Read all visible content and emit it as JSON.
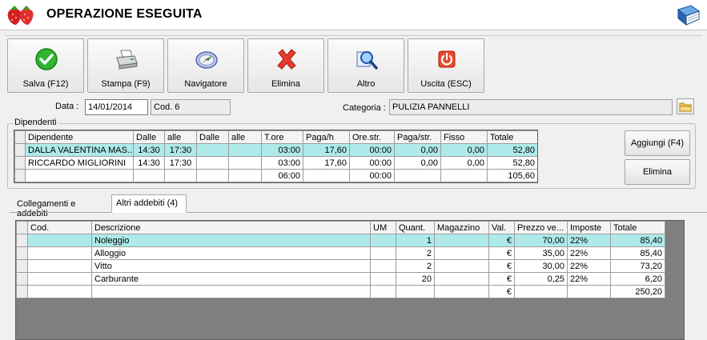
{
  "window": {
    "title": "OPERAZIONE ESEGUITA"
  },
  "toolbar": {
    "buttons": [
      {
        "label": "Salva (F12)",
        "icon": "check-icon"
      },
      {
        "label": "Stampa (F9)",
        "icon": "printer-icon"
      },
      {
        "label": "Navigatore",
        "icon": "compass-icon"
      },
      {
        "label": "Elimina",
        "icon": "red-x-icon"
      },
      {
        "label": "Altro",
        "icon": "magnifier-icon"
      },
      {
        "label": "Uscita (ESC)",
        "icon": "power-icon"
      }
    ]
  },
  "form": {
    "data_label": "Data :",
    "data_value": "14/01/2014",
    "cod_value": "Cod. 6",
    "categoria_label": "Categoria :",
    "categoria_value": "PULIZIA PANNELLI"
  },
  "dipendenti": {
    "group_label": "Dipendenti",
    "columns": [
      "Dipendente",
      "Dalle",
      "alle",
      "Dalle",
      "alle",
      "T.ore",
      "Paga/h",
      "Ore.str.",
      "Paga/str.",
      "Fisso",
      "Totale"
    ],
    "rows": [
      [
        "DALLA VALENTINA MAS...",
        "14:30",
        "17:30",
        "",
        "",
        "03:00",
        "17,60",
        "00:00",
        "0,00",
        "0,00",
        "52,80"
      ],
      [
        "RICCARDO MIGLIORINI",
        "14:30",
        "17:30",
        "",
        "",
        "03:00",
        "17,60",
        "00:00",
        "0,00",
        "0,00",
        "52,80"
      ],
      [
        "",
        "",
        "",
        "",
        "",
        "06:00",
        "",
        "00:00",
        "",
        "",
        "105,60"
      ]
    ],
    "add_button": "Aggiungi (F4)",
    "delete_button": "Elimina"
  },
  "tabs": [
    {
      "label": "Collegamenti e addebiti"
    },
    {
      "label": "Altri addebiti (4)"
    }
  ],
  "addebiti": {
    "columns": [
      "Cod.",
      "Descrizione",
      "UM",
      "Quant.",
      "Magazzino",
      "Val.",
      "Prezzo ve...",
      "Imposte",
      "Totale"
    ],
    "rows": [
      [
        "",
        "Noleggio",
        "",
        "1",
        "",
        "€",
        "70,00",
        "22%",
        "85,40"
      ],
      [
        "",
        "Alloggio",
        "",
        "2",
        "",
        "€",
        "35,00",
        "22%",
        "85,40"
      ],
      [
        "",
        "Vitto",
        "",
        "2",
        "",
        "€",
        "30,00",
        "22%",
        "73,20"
      ],
      [
        "",
        "Carburante",
        "",
        "20",
        "",
        "€",
        "0,25",
        "22%",
        "6,20"
      ],
      [
        "",
        "",
        "",
        "",
        "",
        "€",
        "",
        "",
        "250,20"
      ]
    ]
  },
  "colors": {
    "selected_row": "#aeeaea",
    "grid_background": "#7f7f7f"
  }
}
